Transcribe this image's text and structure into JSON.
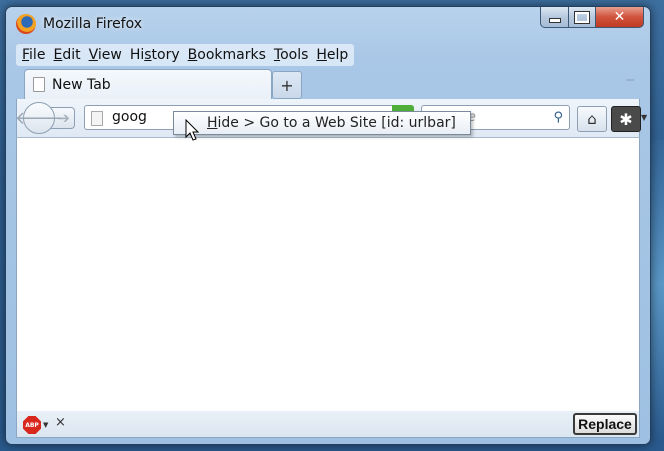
{
  "window": {
    "title": "Mozilla Firefox"
  },
  "menubar": [
    "File",
    "Edit",
    "View",
    "History",
    "Bookmarks",
    "Tools",
    "Help"
  ],
  "menubar_accel": [
    "F",
    "E",
    "V",
    "s",
    "B",
    "T",
    "H"
  ],
  "tab": {
    "label": "New Tab",
    "new_tab_glyph": "+"
  },
  "navbar": {
    "url_value": "goog",
    "search_placeholder": "Google",
    "search_visible": "ogle"
  },
  "tooltip": {
    "accel": "H",
    "rest": "ide > Go to a Web Site [id: urlbar]"
  },
  "statusbar": {
    "close_glyph": "×",
    "replace_label": "Replace",
    "abp_text": "ABP"
  },
  "icons": [
    "firefox-logo",
    "page-icon",
    "back-arrow-icon",
    "forward-arrow-icon",
    "search-icon",
    "home-icon",
    "extension-icon",
    "adblock-icon",
    "close-icon",
    "cursor-icon"
  ],
  "colors": {
    "go_button": "#4fae3a",
    "close_button": "#c03a22",
    "abp": "#d8281e"
  }
}
